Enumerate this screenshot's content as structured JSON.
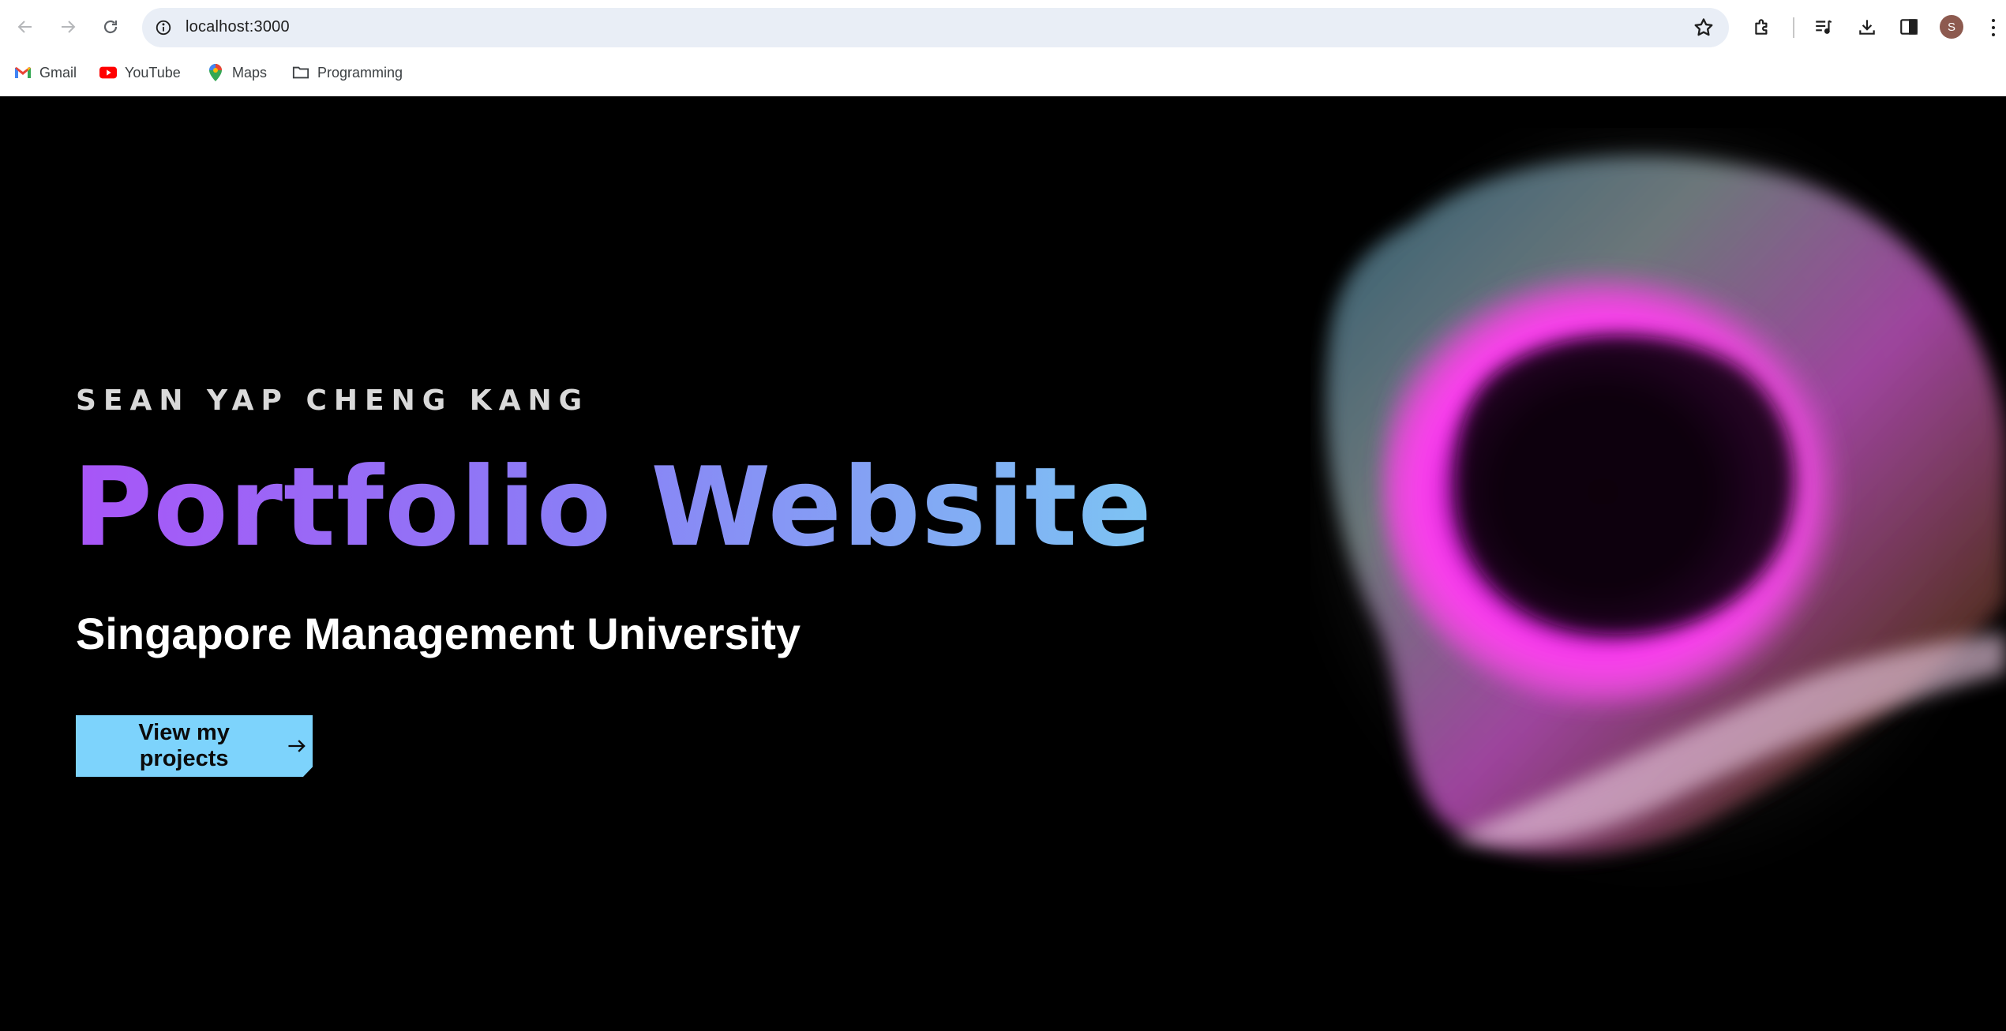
{
  "browser": {
    "url": "localhost:3000",
    "bookmarks": [
      {
        "label": "Gmail",
        "icon": "gmail-icon"
      },
      {
        "label": "YouTube",
        "icon": "youtube-icon"
      },
      {
        "label": "Maps",
        "icon": "maps-icon"
      },
      {
        "label": "Programming",
        "icon": "folder-icon"
      }
    ],
    "avatar_initial": "S"
  },
  "hero": {
    "eyebrow": "SEAN YAP CHENG KANG",
    "headline": "Portfolio Website",
    "subtitle": "Singapore Management University",
    "cta_label": "View my projects"
  },
  "colors": {
    "background": "#000000",
    "gradient_start": "#a855f7",
    "gradient_end": "#7dc4f3",
    "cta_background": "#7dd3fc",
    "blob_accent": "#ff2bf0"
  }
}
